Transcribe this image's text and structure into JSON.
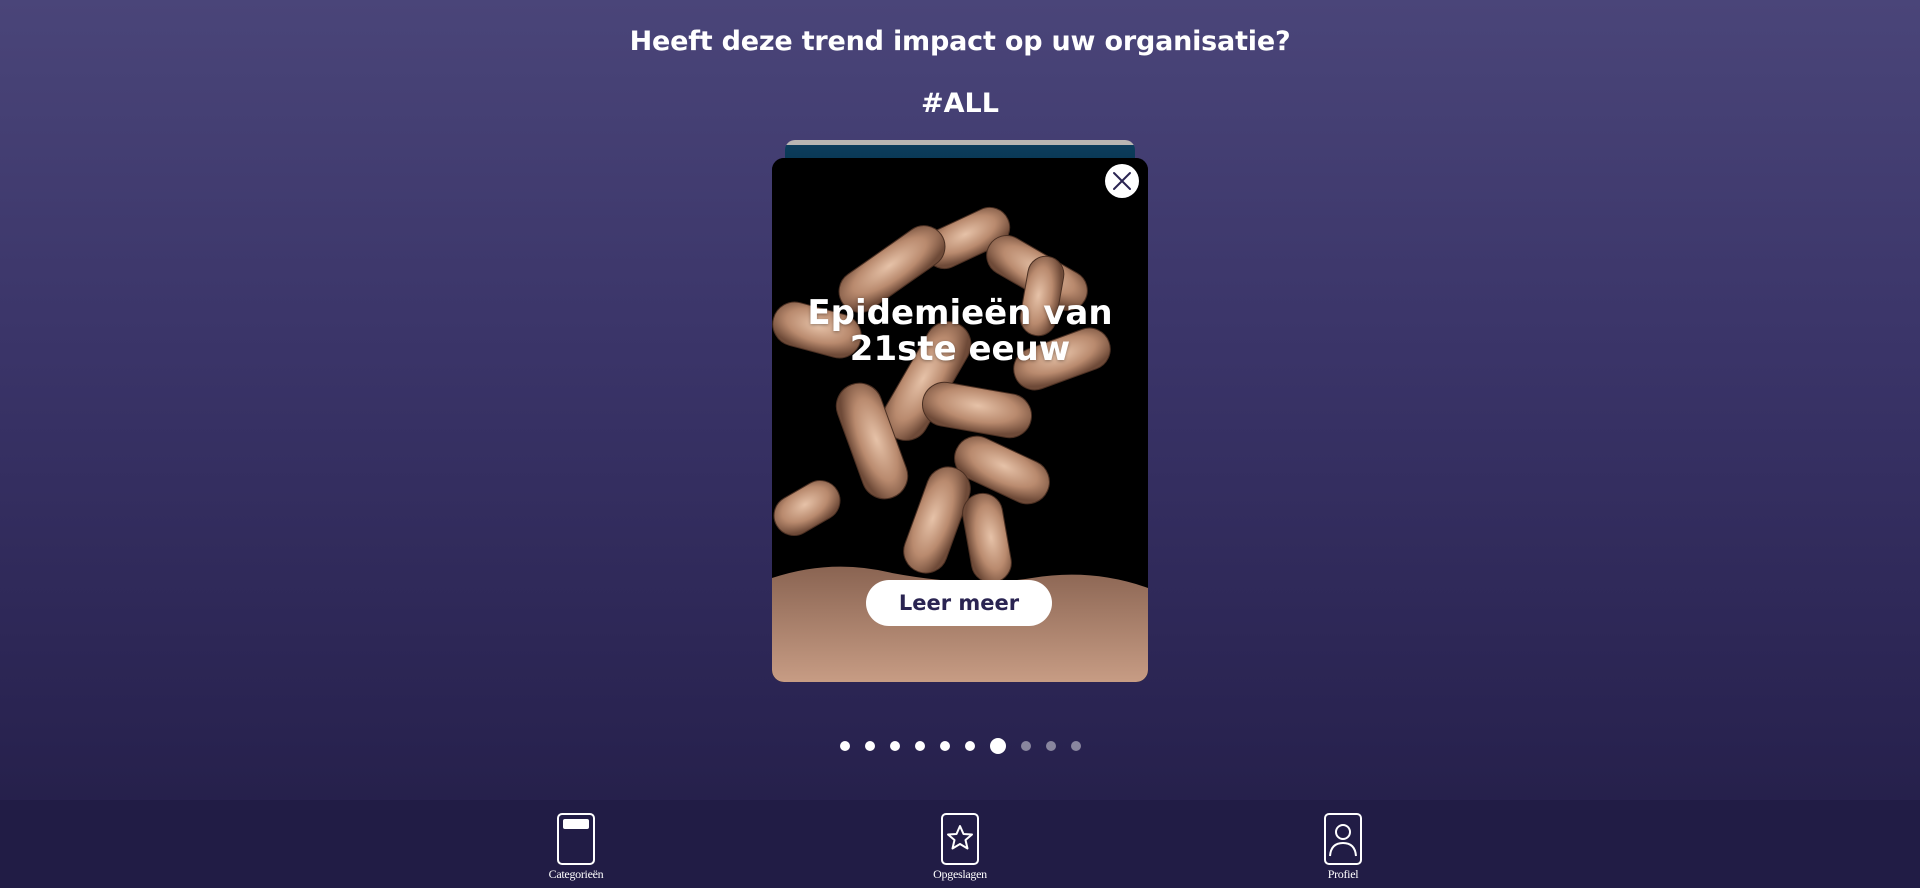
{
  "header": {
    "question": "Heeft deze trend impact op uw organisatie?",
    "tag": "#ALL"
  },
  "card": {
    "title": "Epidemieën van 21ste eeuw",
    "cta_label": "Leer meer"
  },
  "pagination": {
    "total": 10,
    "active_index": 6
  },
  "nav": {
    "items": [
      {
        "label": "Categorieën",
        "icon": "card-icon"
      },
      {
        "label": "Opgeslagen",
        "icon": "star-icon"
      },
      {
        "label": "Profiel",
        "icon": "profile-icon"
      }
    ]
  }
}
